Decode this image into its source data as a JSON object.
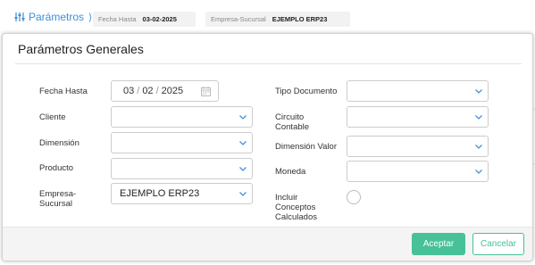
{
  "topbar": {
    "params_label": "Parámetros",
    "params_chevron": "⟩",
    "chips": [
      {
        "key": "Fecha Hasta",
        "value": "03-02-2025"
      },
      {
        "key": "Empresa-Sucursal",
        "value": "EJEMPLO ERP23"
      }
    ]
  },
  "modal": {
    "title": "Parámetros Generales",
    "left_fields": {
      "fecha_hasta": {
        "label": "Fecha Hasta",
        "day": "03",
        "month": "02",
        "year": "2025",
        "separator": "/"
      },
      "cliente": {
        "label": "Cliente",
        "value": ""
      },
      "dimension": {
        "label": "Dimensión",
        "value": ""
      },
      "producto": {
        "label": "Producto",
        "value": ""
      },
      "empresa_sucursal": {
        "label_line1": "Empresa-",
        "label_line2": "Sucursal",
        "value": "EJEMPLO ERP23"
      }
    },
    "right_fields": {
      "tipo_documento": {
        "label": "Tipo Documento",
        "value": ""
      },
      "circuito_contable": {
        "label_line1": "Circuito",
        "label_line2": "Contable",
        "value": ""
      },
      "dimension_valor": {
        "label": "Dimensión Valor",
        "value": ""
      },
      "moneda": {
        "label": "Moneda",
        "value": ""
      },
      "incluir_conceptos": {
        "label_line1": "Incluir",
        "label_line2": "Conceptos",
        "label_line3": "Calculados",
        "checked": false
      }
    },
    "footer": {
      "accept_label": "Aceptar",
      "cancel_label": "Cancelar"
    }
  },
  "colors": {
    "accent_blue": "#3b8fd9",
    "accept_green": "#46c198"
  },
  "icons": {
    "params": "sliders-icon",
    "calendar": "calendar-icon",
    "dropdown": "chevron-down-icon"
  }
}
